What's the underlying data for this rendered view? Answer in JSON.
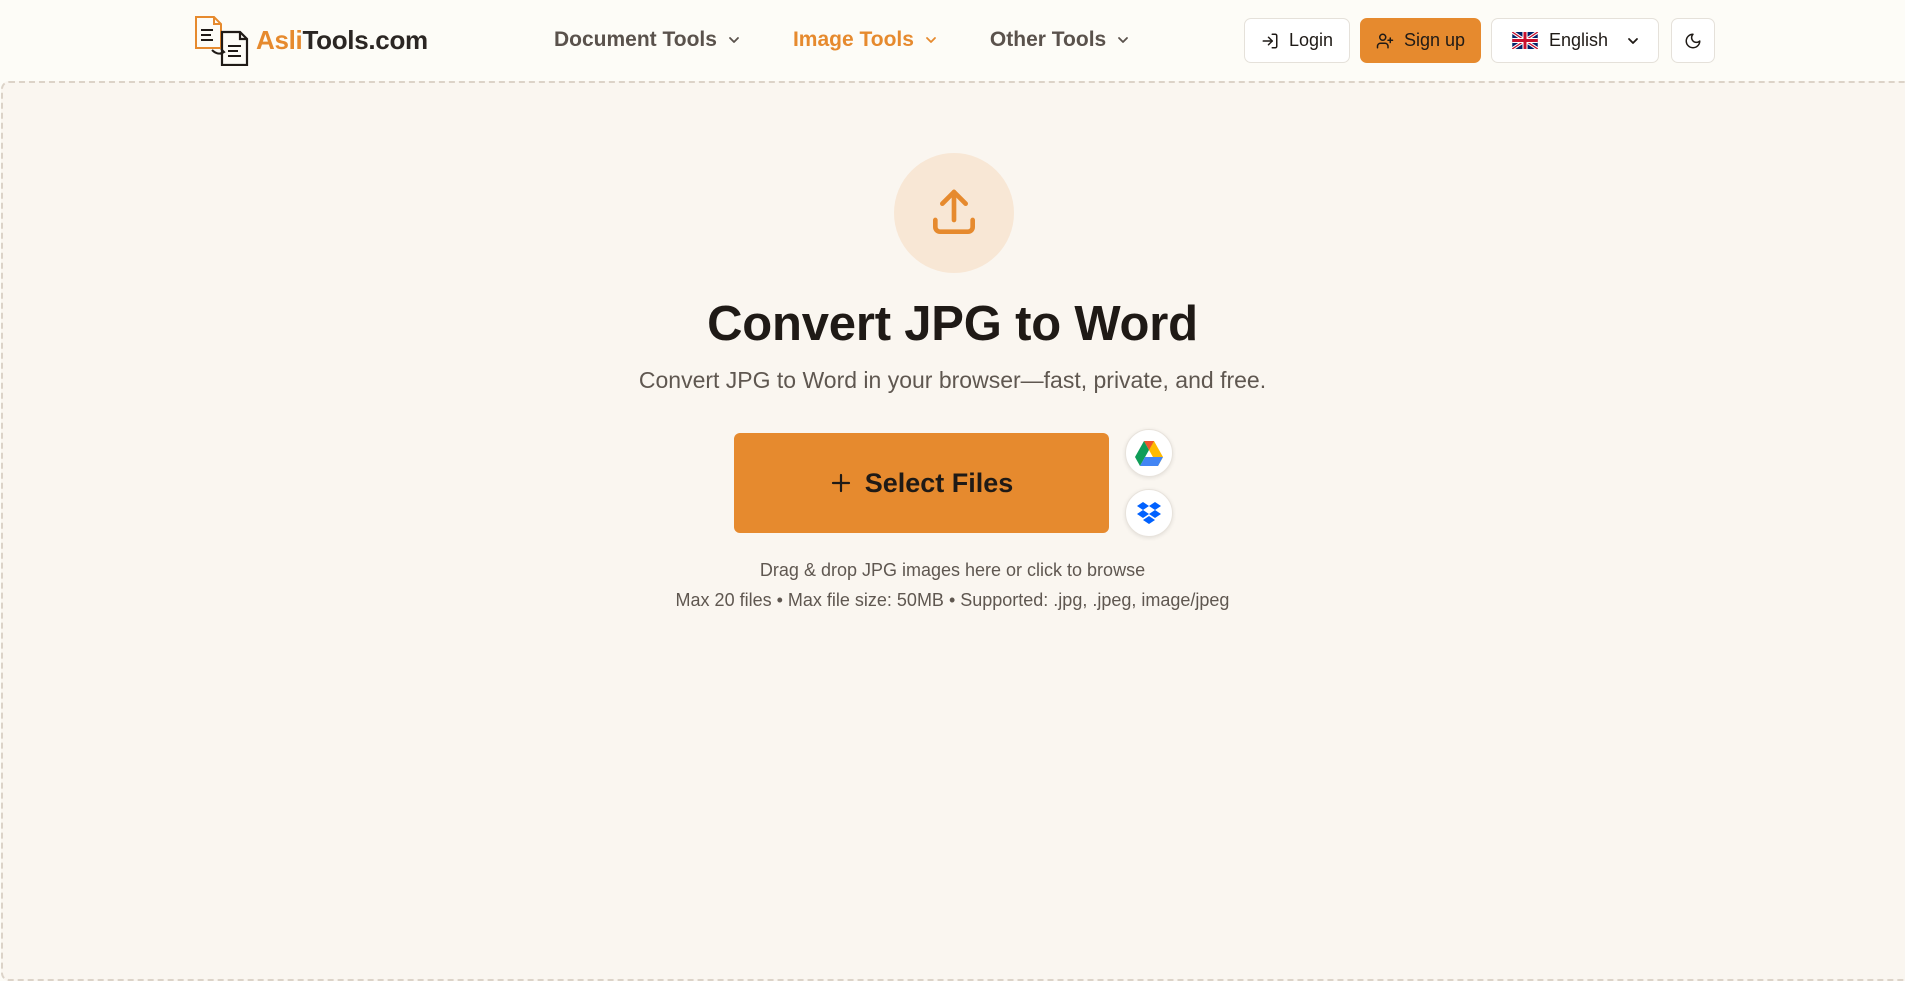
{
  "header": {
    "logo": {
      "accent": "Asli",
      "rest": "Tools.com"
    },
    "nav": [
      {
        "label": "Document Tools",
        "active": false
      },
      {
        "label": "Image Tools",
        "active": true
      },
      {
        "label": "Other Tools",
        "active": false
      }
    ],
    "login_label": "Login",
    "signup_label": "Sign up",
    "language_label": "English",
    "icons": {
      "login": "login-icon",
      "signup": "user-plus-icon",
      "language": "uk-flag-icon",
      "theme": "moon-icon"
    }
  },
  "main": {
    "title": "Convert JPG to Word",
    "subtitle": "Convert JPG to Word in your browser—fast, private, and free.",
    "select_label": "Select Files",
    "drop_hint": "Drag & drop JPG images here or click to browse",
    "limits": "Max 20 files • Max file size: 50MB • Supported: .jpg, .jpeg, image/jpeg",
    "icons": {
      "upload": "upload-icon",
      "google_drive": "google-drive-icon",
      "dropbox": "dropbox-icon"
    }
  },
  "colors": {
    "accent": "#e68a2e",
    "background": "#faf6f0",
    "header_background": "#fdfcf7",
    "text": "#1f1a16"
  }
}
